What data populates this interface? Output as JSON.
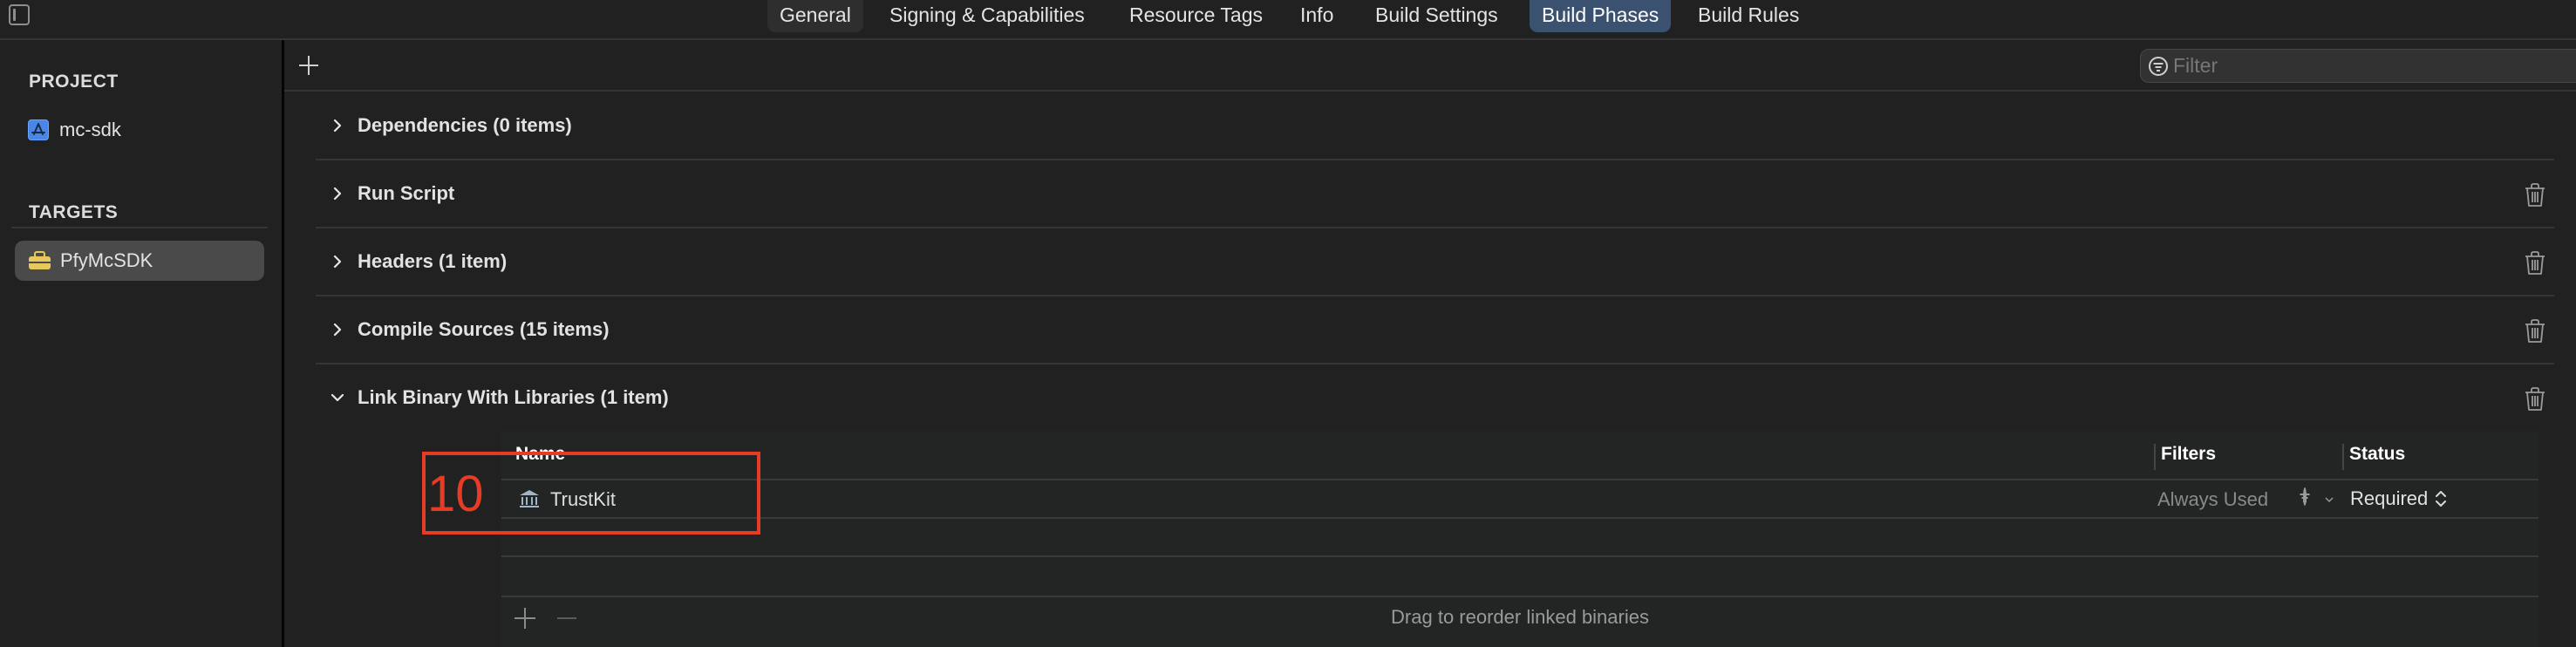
{
  "tabs": [
    {
      "label": "General",
      "state": "hover"
    },
    {
      "label": "Signing & Capabilities",
      "state": "normal"
    },
    {
      "label": "Resource Tags",
      "state": "normal"
    },
    {
      "label": "Info",
      "state": "normal"
    },
    {
      "label": "Build Settings",
      "state": "normal"
    },
    {
      "label": "Build Phases",
      "state": "selected"
    },
    {
      "label": "Build Rules",
      "state": "normal"
    }
  ],
  "sidebar": {
    "project_header": "PROJECT",
    "project_item": {
      "label": "mc-sdk",
      "icon": "app-store-icon"
    },
    "targets_header": "TARGETS",
    "target_item": {
      "label": "PfyMcSDK",
      "icon": "toolbox-icon",
      "selected": true
    }
  },
  "toolbar": {
    "add_icon": "plus-icon",
    "filter_placeholder": "Filter",
    "filter_value": ""
  },
  "phases": [
    {
      "title": "Dependencies (0 items)",
      "expanded": false,
      "deletable": false
    },
    {
      "title": "Run Script",
      "expanded": false,
      "deletable": true
    },
    {
      "title": "Headers (1 item)",
      "expanded": false,
      "deletable": true
    },
    {
      "title": "Compile Sources (15 items)",
      "expanded": false,
      "deletable": true
    },
    {
      "title": "Link Binary With Libraries (1 item)",
      "expanded": true,
      "deletable": true
    }
  ],
  "libraries_table": {
    "columns": [
      "Name",
      "Filters",
      "Status"
    ],
    "rows": [
      {
        "name": "TrustKit",
        "icon": "framework-icon",
        "filters": "Always Used",
        "status": "Required"
      }
    ],
    "footer": "Drag to reorder linked binaries"
  },
  "annotation": {
    "label": "10",
    "color": "#e63b25"
  },
  "colors": {
    "accent_tab": "#3a5170",
    "background": "#212121",
    "annotation": "#e63b25"
  }
}
